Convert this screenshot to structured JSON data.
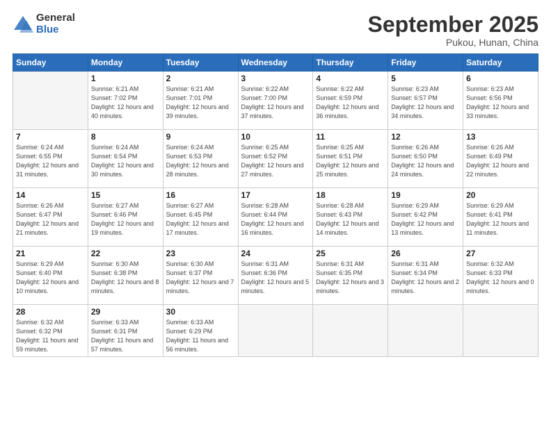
{
  "header": {
    "logo_general": "General",
    "logo_blue": "Blue",
    "month_title": "September 2025",
    "location": "Pukou, Hunan, China"
  },
  "weekdays": [
    "Sunday",
    "Monday",
    "Tuesday",
    "Wednesday",
    "Thursday",
    "Friday",
    "Saturday"
  ],
  "weeks": [
    [
      {
        "day": "",
        "sunrise": "",
        "sunset": "",
        "daylight": ""
      },
      {
        "day": "1",
        "sunrise": "Sunrise: 6:21 AM",
        "sunset": "Sunset: 7:02 PM",
        "daylight": "Daylight: 12 hours and 40 minutes."
      },
      {
        "day": "2",
        "sunrise": "Sunrise: 6:21 AM",
        "sunset": "Sunset: 7:01 PM",
        "daylight": "Daylight: 12 hours and 39 minutes."
      },
      {
        "day": "3",
        "sunrise": "Sunrise: 6:22 AM",
        "sunset": "Sunset: 7:00 PM",
        "daylight": "Daylight: 12 hours and 37 minutes."
      },
      {
        "day": "4",
        "sunrise": "Sunrise: 6:22 AM",
        "sunset": "Sunset: 6:59 PM",
        "daylight": "Daylight: 12 hours and 36 minutes."
      },
      {
        "day": "5",
        "sunrise": "Sunrise: 6:23 AM",
        "sunset": "Sunset: 6:57 PM",
        "daylight": "Daylight: 12 hours and 34 minutes."
      },
      {
        "day": "6",
        "sunrise": "Sunrise: 6:23 AM",
        "sunset": "Sunset: 6:56 PM",
        "daylight": "Daylight: 12 hours and 33 minutes."
      }
    ],
    [
      {
        "day": "7",
        "sunrise": "Sunrise: 6:24 AM",
        "sunset": "Sunset: 6:55 PM",
        "daylight": "Daylight: 12 hours and 31 minutes."
      },
      {
        "day": "8",
        "sunrise": "Sunrise: 6:24 AM",
        "sunset": "Sunset: 6:54 PM",
        "daylight": "Daylight: 12 hours and 30 minutes."
      },
      {
        "day": "9",
        "sunrise": "Sunrise: 6:24 AM",
        "sunset": "Sunset: 6:53 PM",
        "daylight": "Daylight: 12 hours and 28 minutes."
      },
      {
        "day": "10",
        "sunrise": "Sunrise: 6:25 AM",
        "sunset": "Sunset: 6:52 PM",
        "daylight": "Daylight: 12 hours and 27 minutes."
      },
      {
        "day": "11",
        "sunrise": "Sunrise: 6:25 AM",
        "sunset": "Sunset: 6:51 PM",
        "daylight": "Daylight: 12 hours and 25 minutes."
      },
      {
        "day": "12",
        "sunrise": "Sunrise: 6:26 AM",
        "sunset": "Sunset: 6:50 PM",
        "daylight": "Daylight: 12 hours and 24 minutes."
      },
      {
        "day": "13",
        "sunrise": "Sunrise: 6:26 AM",
        "sunset": "Sunset: 6:49 PM",
        "daylight": "Daylight: 12 hours and 22 minutes."
      }
    ],
    [
      {
        "day": "14",
        "sunrise": "Sunrise: 6:26 AM",
        "sunset": "Sunset: 6:47 PM",
        "daylight": "Daylight: 12 hours and 21 minutes."
      },
      {
        "day": "15",
        "sunrise": "Sunrise: 6:27 AM",
        "sunset": "Sunset: 6:46 PM",
        "daylight": "Daylight: 12 hours and 19 minutes."
      },
      {
        "day": "16",
        "sunrise": "Sunrise: 6:27 AM",
        "sunset": "Sunset: 6:45 PM",
        "daylight": "Daylight: 12 hours and 17 minutes."
      },
      {
        "day": "17",
        "sunrise": "Sunrise: 6:28 AM",
        "sunset": "Sunset: 6:44 PM",
        "daylight": "Daylight: 12 hours and 16 minutes."
      },
      {
        "day": "18",
        "sunrise": "Sunrise: 6:28 AM",
        "sunset": "Sunset: 6:43 PM",
        "daylight": "Daylight: 12 hours and 14 minutes."
      },
      {
        "day": "19",
        "sunrise": "Sunrise: 6:29 AM",
        "sunset": "Sunset: 6:42 PM",
        "daylight": "Daylight: 12 hours and 13 minutes."
      },
      {
        "day": "20",
        "sunrise": "Sunrise: 6:29 AM",
        "sunset": "Sunset: 6:41 PM",
        "daylight": "Daylight: 12 hours and 11 minutes."
      }
    ],
    [
      {
        "day": "21",
        "sunrise": "Sunrise: 6:29 AM",
        "sunset": "Sunset: 6:40 PM",
        "daylight": "Daylight: 12 hours and 10 minutes."
      },
      {
        "day": "22",
        "sunrise": "Sunrise: 6:30 AM",
        "sunset": "Sunset: 6:38 PM",
        "daylight": "Daylight: 12 hours and 8 minutes."
      },
      {
        "day": "23",
        "sunrise": "Sunrise: 6:30 AM",
        "sunset": "Sunset: 6:37 PM",
        "daylight": "Daylight: 12 hours and 7 minutes."
      },
      {
        "day": "24",
        "sunrise": "Sunrise: 6:31 AM",
        "sunset": "Sunset: 6:36 PM",
        "daylight": "Daylight: 12 hours and 5 minutes."
      },
      {
        "day": "25",
        "sunrise": "Sunrise: 6:31 AM",
        "sunset": "Sunset: 6:35 PM",
        "daylight": "Daylight: 12 hours and 3 minutes."
      },
      {
        "day": "26",
        "sunrise": "Sunrise: 6:31 AM",
        "sunset": "Sunset: 6:34 PM",
        "daylight": "Daylight: 12 hours and 2 minutes."
      },
      {
        "day": "27",
        "sunrise": "Sunrise: 6:32 AM",
        "sunset": "Sunset: 6:33 PM",
        "daylight": "Daylight: 12 hours and 0 minutes."
      }
    ],
    [
      {
        "day": "28",
        "sunrise": "Sunrise: 6:32 AM",
        "sunset": "Sunset: 6:32 PM",
        "daylight": "Daylight: 11 hours and 59 minutes."
      },
      {
        "day": "29",
        "sunrise": "Sunrise: 6:33 AM",
        "sunset": "Sunset: 6:31 PM",
        "daylight": "Daylight: 11 hours and 57 minutes."
      },
      {
        "day": "30",
        "sunrise": "Sunrise: 6:33 AM",
        "sunset": "Sunset: 6:29 PM",
        "daylight": "Daylight: 11 hours and 56 minutes."
      },
      {
        "day": "",
        "sunrise": "",
        "sunset": "",
        "daylight": ""
      },
      {
        "day": "",
        "sunrise": "",
        "sunset": "",
        "daylight": ""
      },
      {
        "day": "",
        "sunrise": "",
        "sunset": "",
        "daylight": ""
      },
      {
        "day": "",
        "sunrise": "",
        "sunset": "",
        "daylight": ""
      }
    ]
  ]
}
